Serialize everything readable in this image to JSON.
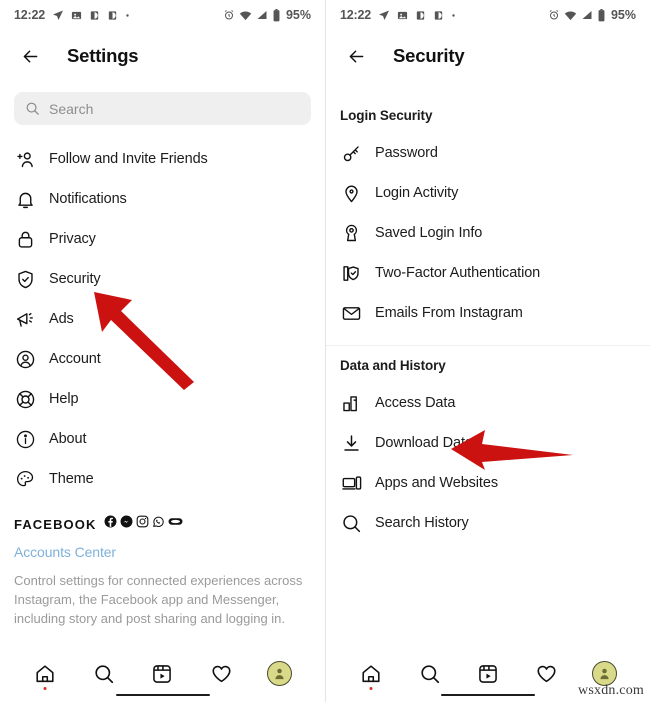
{
  "status_bar": {
    "time": "12:22",
    "battery_percent": "95%",
    "left_icons": [
      "send-icon",
      "photo-icon",
      "battery-saver-icon",
      "battery-saver-icon",
      "dot-icon"
    ],
    "right_icons": [
      "alarm-icon",
      "wifi-icon",
      "signal-icon",
      "battery-icon"
    ]
  },
  "left_screen": {
    "header": {
      "title": "Settings",
      "back_icon": "arrow-left-icon"
    },
    "search": {
      "placeholder": "Search",
      "icon": "search-icon"
    },
    "menu": [
      {
        "label": "Follow and Invite Friends",
        "icon": "add-person-icon"
      },
      {
        "label": "Notifications",
        "icon": "bell-icon"
      },
      {
        "label": "Privacy",
        "icon": "lock-icon"
      },
      {
        "label": "Security",
        "icon": "shield-check-icon"
      },
      {
        "label": "Ads",
        "icon": "megaphone-icon"
      },
      {
        "label": "Account",
        "icon": "person-circle-icon"
      },
      {
        "label": "Help",
        "icon": "lifebuoy-icon"
      },
      {
        "label": "About",
        "icon": "info-circle-icon"
      },
      {
        "label": "Theme",
        "icon": "palette-icon"
      }
    ],
    "facebook_block": {
      "brand": "FACEBOOK",
      "brand_icons": [
        "facebook-icon",
        "messenger-icon",
        "instagram-icon",
        "whatsapp-icon",
        "oculus-icon"
      ],
      "link": "Accounts Center",
      "link_color": "#7eb1db",
      "description": "Control settings for connected experiences across Instagram, the Facebook app and Messenger, including story and post sharing and logging in."
    }
  },
  "right_screen": {
    "header": {
      "title": "Security",
      "back_icon": "arrow-left-icon"
    },
    "sections": [
      {
        "title": "Login Security",
        "items": [
          {
            "label": "Password",
            "icon": "key-icon"
          },
          {
            "label": "Login Activity",
            "icon": "location-pin-icon"
          },
          {
            "label": "Saved Login Info",
            "icon": "keyhole-icon"
          },
          {
            "label": "Two-Factor Authentication",
            "icon": "shield-phone-icon"
          },
          {
            "label": "Emails From Instagram",
            "icon": "envelope-icon"
          }
        ]
      },
      {
        "title": "Data and History",
        "items": [
          {
            "label": "Access Data",
            "icon": "bar-chart-icon"
          },
          {
            "label": "Download Data",
            "icon": "download-icon"
          },
          {
            "label": "Apps and Websites",
            "icon": "devices-icon"
          },
          {
            "label": "Search History",
            "icon": "search-icon"
          }
        ]
      }
    ]
  },
  "bottom_nav": {
    "items": [
      {
        "icon": "home-icon",
        "badge": true
      },
      {
        "icon": "search-icon",
        "badge": false
      },
      {
        "icon": "reels-icon",
        "badge": false
      },
      {
        "icon": "heart-icon",
        "badge": false
      },
      {
        "icon": "profile-avatar",
        "badge": false
      }
    ]
  },
  "annotations": {
    "arrow_color": "#cc1111",
    "arrow_left_target": "Security",
    "arrow_right_target": "Download Data"
  },
  "watermark": "wsxdn.com"
}
